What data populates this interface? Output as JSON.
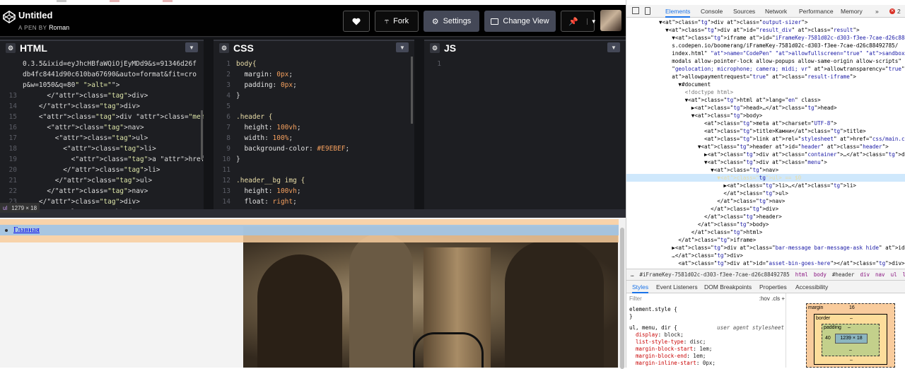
{
  "pen": {
    "title": "Untitled",
    "by_prefix": "A PEN BY",
    "author": "Roman"
  },
  "toolbar": {
    "fork_label": "Fork",
    "settings_label": "Settings",
    "change_view_label": "Change View"
  },
  "editors": {
    "html": {
      "label": "HTML",
      "lines": [
        {
          "n": "",
          "t": "0.3.5&ixid=eyJhcHBfaWQiOjEyMDd9&s=91346d26f"
        },
        {
          "n": "",
          "t": "db4fc8441d90c610ba67690&auto=format&fit=cro"
        },
        {
          "n": "",
          "t": "p&w=1050&q=80\" alt=\"\">"
        },
        {
          "n": "13",
          "t": "      </div>"
        },
        {
          "n": "14",
          "t": "    </div>"
        },
        {
          "n": "15",
          "t": "    <div class=\"menu\">"
        },
        {
          "n": "16",
          "t": "      <nav>"
        },
        {
          "n": "17",
          "t": "        <ul>"
        },
        {
          "n": "18",
          "t": "          <li>"
        },
        {
          "n": "19",
          "t": "            <a href=\"#\">Главная</a>"
        },
        {
          "n": "20",
          "t": "          </li>"
        },
        {
          "n": "21",
          "t": "        </ul>"
        },
        {
          "n": "22",
          "t": "      </nav>"
        },
        {
          "n": "23",
          "t": "    </div>"
        },
        {
          "n": "24",
          "t": "  </header>"
        }
      ]
    },
    "css": {
      "label": "CSS",
      "lines": [
        {
          "n": "1",
          "t": "body{"
        },
        {
          "n": "2",
          "t": "  margin: 0px;"
        },
        {
          "n": "3",
          "t": "  padding: 0px;"
        },
        {
          "n": "4",
          "t": "}"
        },
        {
          "n": "5",
          "t": ""
        },
        {
          "n": "6",
          "t": ".header {"
        },
        {
          "n": "7",
          "t": "  height: 100vh;"
        },
        {
          "n": "8",
          "t": "  width: 100%;"
        },
        {
          "n": "9",
          "t": "  background-color: #E9EBEF;"
        },
        {
          "n": "10",
          "t": "}"
        },
        {
          "n": "11",
          "t": ""
        },
        {
          "n": "12",
          "t": ".header__bg img {"
        },
        {
          "n": "13",
          "t": "  height: 100vh;"
        },
        {
          "n": "14",
          "t": "  float: right;"
        }
      ]
    },
    "js": {
      "label": "JS",
      "lines": [
        {
          "n": "1",
          "t": ""
        }
      ]
    }
  },
  "result": {
    "link_text": "Главная"
  },
  "inspect_tooltip": {
    "element": "ul",
    "size": "1279 × 18"
  },
  "devtools": {
    "tabs": [
      "Elements",
      "Console",
      "Sources",
      "Network",
      "Performance",
      "Memory",
      "»"
    ],
    "error_count": "2",
    "dom_lines": [
      "▼<div class=\"output-sizer\">",
      "  ▼<div id=\"result_div\" class=\"result\">",
      "    ▼<iframe id=\"iFrameKey-7581d02c-d303-f3ee-7cae-d26c88492785\" src=\"https://",
      "    s.codepen.io/boomerang/iFrameKey-7581d02c-d303-f3ee-7cae-d26c88492785/",
      "    index.html\" name=\"CodePen\" allowfullscreen=\"true\" sandbox=\"allow-forms al",
      "    modals allow-pointer-lock allow-popups allow-same-origin allow-scripts\" a",
      "    \"geolocation; microphone; camera; midi; vr\" allowtransparency=\"true\"",
      "    allowpaymentrequest=\"true\" class=\"result-iframe\">",
      "      ▼#document",
      "        <!doctype html>",
      "        ▼<html lang=\"en\" class>",
      "          ▶<head>…</head>",
      "          ▼<body>",
      "              <meta charset=\"UTF-8\">",
      "              <title>Камни</title>",
      "              <link rel=\"stylesheet\" href=\"css/main.css\">",
      "            ▼<header id=\"header\" class=\"header\">",
      "              ▶<div class=\"container\">…</div>",
      "              ▼<div class=\"menu\">",
      "                ▼<nav>",
      "                  ▼<ul> == $0",
      "                    ▶<li>…</li>",
      "                    </ul>",
      "                  </nav>",
      "                </div>",
      "              </header>",
      "            </body>",
      "          </html>",
      "      </iframe>",
      "    ▶<div class=\"bar-message bar-message-ask hide\" id=\"packages-building-mess",
      "    …</div>",
      "      <div id=\"asset-bin-goes-here\"></div>",
      "      <section id=\"drawer\" class=\"drawer\">"
    ],
    "selected_line_index": 20,
    "breadcrumbs": [
      "…",
      "#iFrameKey-7581d02c-d303-f3ee-7cae-d26c88492785",
      "html",
      "body",
      "#header",
      "div",
      "nav",
      "ul",
      "li"
    ],
    "styles_tabs": [
      "Styles",
      "Event Listeners",
      "DOM Breakpoints",
      "Properties",
      "Accessibility"
    ],
    "filter_placeholder": "Filter",
    "filter_buttons": ":hov  .cls  +",
    "style_lines": [
      {
        "t": "element.style {",
        "kind": "sel"
      },
      {
        "t": "}",
        "kind": "sel"
      },
      {
        "t": "ul, menu, dir {",
        "kind": "sel",
        "src": "user agent stylesheet"
      },
      {
        "t": "  display: block;",
        "kind": "prop"
      },
      {
        "t": "  list-style-type: disc;",
        "kind": "prop"
      },
      {
        "t": "  margin-block-start: 1em;",
        "kind": "prop"
      },
      {
        "t": "  margin-block-end: 1em;",
        "kind": "prop"
      },
      {
        "t": "  margin-inline-start: 0px;",
        "kind": "prop"
      }
    ],
    "box_model": {
      "margin_label": "margin",
      "margin_top": "16",
      "border_label": "border",
      "border_val": "–",
      "padding_label": "padding",
      "padding_val": "–",
      "padding_left": "40",
      "content": "1239 × 18",
      "dash": "–"
    }
  }
}
